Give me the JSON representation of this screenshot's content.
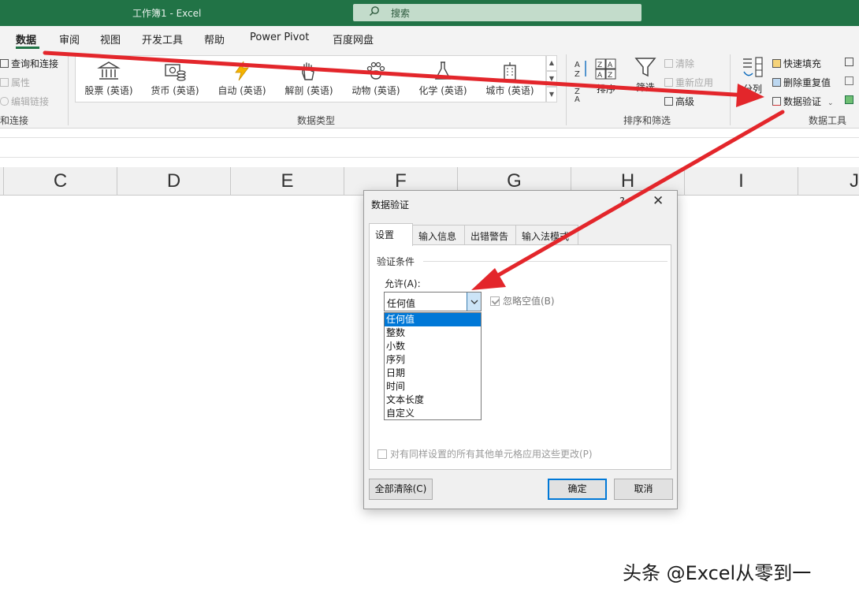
{
  "window": {
    "title": "工作簿1  -  Excel"
  },
  "search": {
    "label": "搜索",
    "icon": "search-icon"
  },
  "menu": {
    "tabs": [
      "数据",
      "审阅",
      "视图",
      "开发工具",
      "帮助",
      "Power Pivot",
      "百度网盘"
    ],
    "active": "数据"
  },
  "ribbon": {
    "queries": {
      "items": [
        "查询和连接",
        "属性",
        "编辑链接"
      ],
      "label": "和连接"
    },
    "data_types": {
      "items": [
        "股票 (英语)",
        "货币 (英语)",
        "自动 (英语)",
        "解剖 (英语)",
        "动物 (英语)",
        "化学 (英语)",
        "城市 (英语)"
      ],
      "label": "数据类型"
    },
    "sort_filter": {
      "sort": "排序",
      "filter": "筛选",
      "clear": "清除",
      "reapply": "重新应用",
      "advanced": "高级",
      "label": "排序和筛选"
    },
    "data_tools": {
      "split": "分列",
      "flash_fill": "快速填充",
      "remove_dup": "删除重复值",
      "validation": "数据验证",
      "label": "数据工具"
    }
  },
  "columns": [
    "C",
    "D",
    "E",
    "F",
    "G",
    "H",
    "I",
    "J"
  ],
  "dialog": {
    "title": "数据验证",
    "help": "?",
    "close": "✕",
    "tabs": [
      "设置",
      "输入信息",
      "出错警告",
      "输入法模式"
    ],
    "active_tab": "设置",
    "section": "验证条件",
    "allow_label": "允许(A):",
    "allow_value": "任何值",
    "ignore_blank": "忽略空值(B)",
    "options": [
      "任何值",
      "整数",
      "小数",
      "序列",
      "日期",
      "时间",
      "文本长度",
      "自定义"
    ],
    "selected_option": "任何值",
    "apply_all": "对有同样设置的所有其他单元格应用这些更改(P)",
    "clear_all": "全部清除(C)",
    "ok": "确定",
    "cancel": "取消"
  },
  "watermark": "头条 @Excel从零到一",
  "colors": {
    "excel_green": "#217346",
    "annotation_arrow": "#e3262b",
    "selection_blue": "#0078d7"
  }
}
